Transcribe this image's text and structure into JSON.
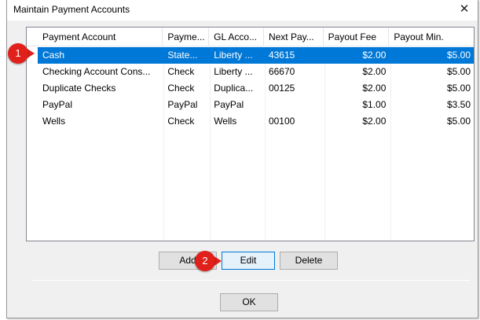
{
  "window": {
    "title": "Maintain Payment Accounts",
    "close_glyph": "✕"
  },
  "table": {
    "columns": [
      "Payment Account",
      "Payme...",
      "GL Acco...",
      "Next Pay...",
      "Payout Fee",
      "Payout Min."
    ],
    "rows": [
      [
        "Cash",
        "State...",
        "Liberty ...",
        "43615",
        "$2.00",
        "$5.00"
      ],
      [
        "Checking Account Cons...",
        "Check",
        "Liberty ...",
        "66670",
        "$2.00",
        "$5.00"
      ],
      [
        "Duplicate Checks",
        "Check",
        "Duplica...",
        "00125",
        "$2.00",
        "$5.00"
      ],
      [
        "PayPal",
        "PayPal",
        "PayPal",
        "",
        "$1.00",
        "$3.50"
      ],
      [
        "Wells",
        "Check",
        "Wells",
        "00100",
        "$2.00",
        "$5.00"
      ]
    ],
    "selected_row": 0
  },
  "buttons": {
    "add": "Add",
    "edit": "Edit",
    "delete": "Delete",
    "ok": "OK"
  },
  "markers": {
    "one": "1",
    "two": "2"
  },
  "colors": {
    "selection": "#0078d7",
    "marker": "#e0201b"
  }
}
